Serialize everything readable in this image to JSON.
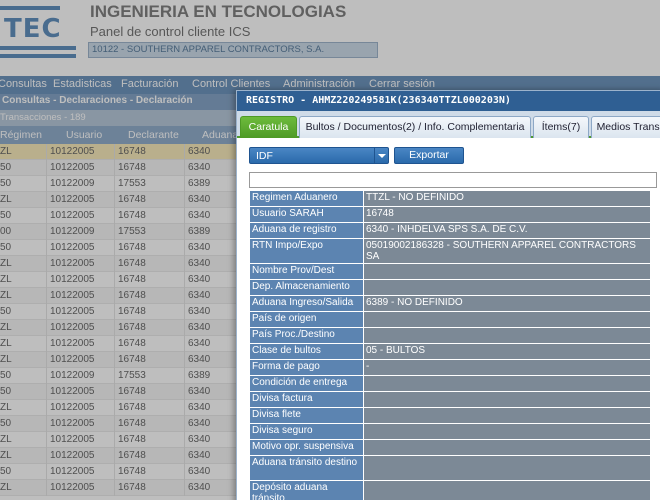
{
  "header": {
    "logo_text": "TEC",
    "app_title": "INGENIERIA EN TECNOLOGIAS",
    "app_subtitle": "Panel de control cliente ICS",
    "client": "10122 - SOUTHERN APPAREL CONTRACTORS, S.A."
  },
  "menu": {
    "items": [
      "Consultas",
      "Estadisticas",
      "Facturación",
      "Control Clientes",
      "Administración",
      "Cerrar sesión"
    ]
  },
  "breadcrumb": "Consultas - Declaraciones - Declaración",
  "transactions_label": "Transacciones - 189",
  "grid": {
    "headers": [
      "Régimen",
      "Usuario",
      "Declarante",
      "Aduana"
    ],
    "rows": [
      [
        "ZL",
        "10122005",
        "16748",
        "6340"
      ],
      [
        "50",
        "10122005",
        "16748",
        "6340"
      ],
      [
        "50",
        "10122009",
        "17553",
        "6389"
      ],
      [
        "ZL",
        "10122005",
        "16748",
        "6340"
      ],
      [
        "50",
        "10122005",
        "16748",
        "6340"
      ],
      [
        "00",
        "10122009",
        "17553",
        "6389"
      ],
      [
        "50",
        "10122005",
        "16748",
        "6340"
      ],
      [
        "ZL",
        "10122005",
        "16748",
        "6340"
      ],
      [
        "ZL",
        "10122005",
        "16748",
        "6340"
      ],
      [
        "ZL",
        "10122005",
        "16748",
        "6340"
      ],
      [
        "50",
        "10122005",
        "16748",
        "6340"
      ],
      [
        "ZL",
        "10122005",
        "16748",
        "6340"
      ],
      [
        "ZL",
        "10122005",
        "16748",
        "6340"
      ],
      [
        "ZL",
        "10122005",
        "16748",
        "6340"
      ],
      [
        "50",
        "10122009",
        "17553",
        "6389"
      ],
      [
        "50",
        "10122005",
        "16748",
        "6340"
      ],
      [
        "ZL",
        "10122005",
        "16748",
        "6340"
      ],
      [
        "50",
        "10122005",
        "16748",
        "6340"
      ],
      [
        "ZL",
        "10122005",
        "16748",
        "6340"
      ],
      [
        "ZL",
        "10122005",
        "16748",
        "6340"
      ],
      [
        "50",
        "10122005",
        "16748",
        "6340"
      ],
      [
        "ZL",
        "10122005",
        "16748",
        "6340"
      ]
    ]
  },
  "modal": {
    "title": "REGISTRO - AHMZ220249581K(236340TTZL000203N)",
    "tabs": [
      "Caratula",
      "Bultos / Documentos(2) / Info. Complementaria",
      "Ítems(7)",
      "Medios Transp"
    ],
    "select_value": "IDF",
    "export_label": "Exportar",
    "fields": [
      {
        "label": "Regimen Aduanero",
        "value": "TTZL - NO DEFINIDO"
      },
      {
        "label": "Usuario SARAH",
        "value": "16748"
      },
      {
        "label": "Aduana de registro",
        "value": "6340 - INHDELVA SPS S.A. DE C.V."
      },
      {
        "label": "RTN Impo/Expo",
        "value": "05019002186328 - SOUTHERN APPAREL CONTRACTORS SA"
      },
      {
        "label": "Nombre Prov/Dest",
        "value": ""
      },
      {
        "label": "Dep. Almacenamiento",
        "value": ""
      },
      {
        "label": "Aduana Ingreso/Salida",
        "value": "6389 - NO DEFINIDO"
      },
      {
        "label": "País de origen",
        "value": ""
      },
      {
        "label": "País Proc./Destino",
        "value": ""
      },
      {
        "label": "Clase de bultos",
        "value": "05 - BULTOS"
      },
      {
        "label": "Forma de pago",
        "value": "-"
      },
      {
        "label": "Condición de entrega",
        "value": ""
      },
      {
        "label": "Divisa factura",
        "value": ""
      },
      {
        "label": "Divisa flete",
        "value": ""
      },
      {
        "label": "Divisa seguro",
        "value": ""
      },
      {
        "label": "Motivo opr. suspensiva",
        "value": ""
      },
      {
        "label": "Aduana tránsito destino",
        "value": ""
      },
      {
        "label": "Depósito aduana tránsito",
        "value": ""
      }
    ]
  }
}
